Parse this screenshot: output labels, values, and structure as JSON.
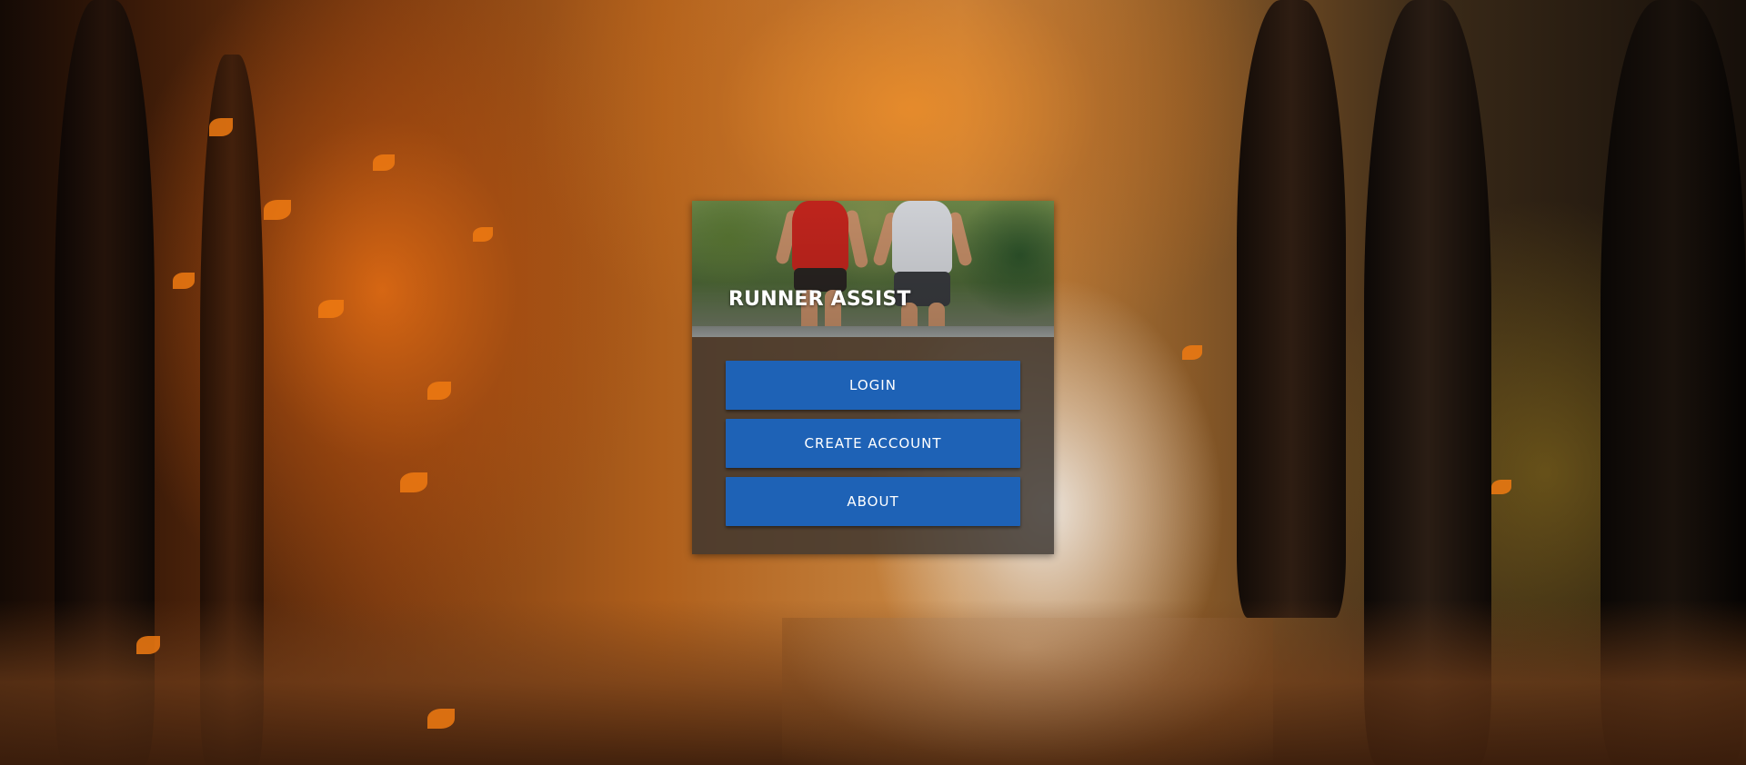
{
  "app": {
    "title": "RUNNER ASSIST"
  },
  "menu": {
    "login_label": "LOGIN",
    "create_account_label": "CREATE ACCOUNT",
    "about_label": "ABOUT"
  },
  "colors": {
    "button": "#1e62b6",
    "card": "#3a3430",
    "title_text": "#ffffff"
  }
}
